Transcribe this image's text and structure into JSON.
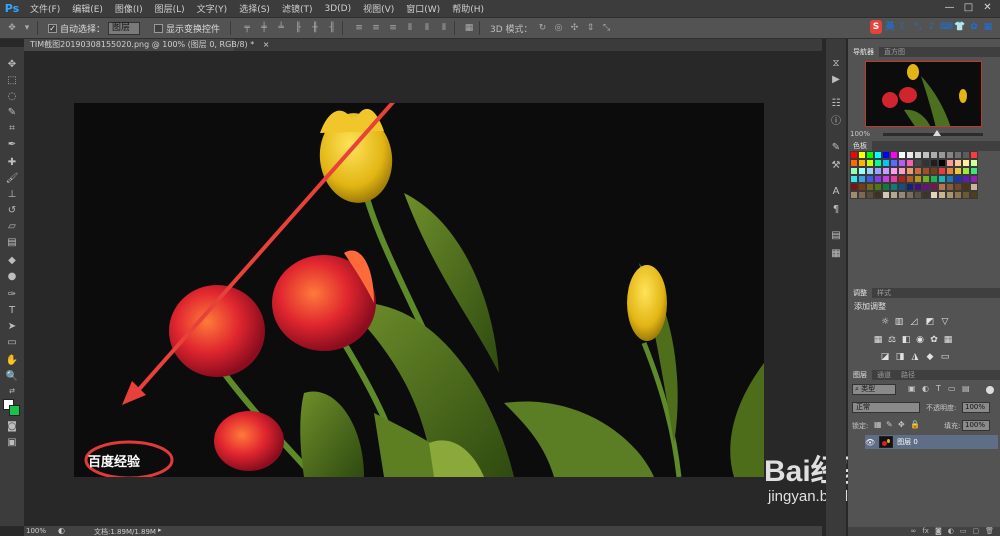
{
  "menubar": {
    "logo": "Ps",
    "items": [
      "文件(F)",
      "编辑(E)",
      "图像(I)",
      "图层(L)",
      "文字(Y)",
      "选择(S)",
      "滤镜(T)",
      "3D(D)",
      "视图(V)",
      "窗口(W)",
      "帮助(H)"
    ],
    "window_controls": [
      "—",
      "□",
      "✕"
    ]
  },
  "options": {
    "auto_select_label": "自动选择：",
    "auto_select_value": "图层",
    "show_transform_label": "显示变换控件",
    "mode_label": "3D 模式：",
    "ime_label": "英"
  },
  "document": {
    "tab_title": "TIM截图20190308155020.png @ 100% (图层 0, RGB/8) *",
    "tab_close": "×"
  },
  "canvas": {
    "watermark_text": "百度经验",
    "brand_text": "Bai经验",
    "brand_url": "jingyan.baidu.com",
    "arrow_color": "#e8413a",
    "circle_color": "#e03a3a"
  },
  "status": {
    "zoom": "100%",
    "doc_info": "文档:1.89M/1.89M"
  },
  "panels": {
    "navigator_tabs": [
      "导航器",
      "直方图"
    ],
    "nav_zoom": "100%",
    "swatch_tab": "色板",
    "adjust_tabs": [
      "调整",
      "样式"
    ],
    "adjust_title": "添加调整",
    "layers_tabs": [
      "图层",
      "通道",
      "路径"
    ],
    "filter_kind": "类型",
    "blend_mode": "正常",
    "opacity_label": "不透明度:",
    "opacity_value": "100%",
    "lock_label": "锁定:",
    "fill_label": "填充:",
    "fill_value": "100%",
    "layer_name": "图层 0"
  },
  "colors": {
    "menubar_bg": "#3c3c3c",
    "optbar_bg": "#535353",
    "panel_bg": "#535353",
    "workspace_bg": "#282828",
    "selected_layer": "#5f6e87",
    "ps_blue": "#31a8ff"
  }
}
